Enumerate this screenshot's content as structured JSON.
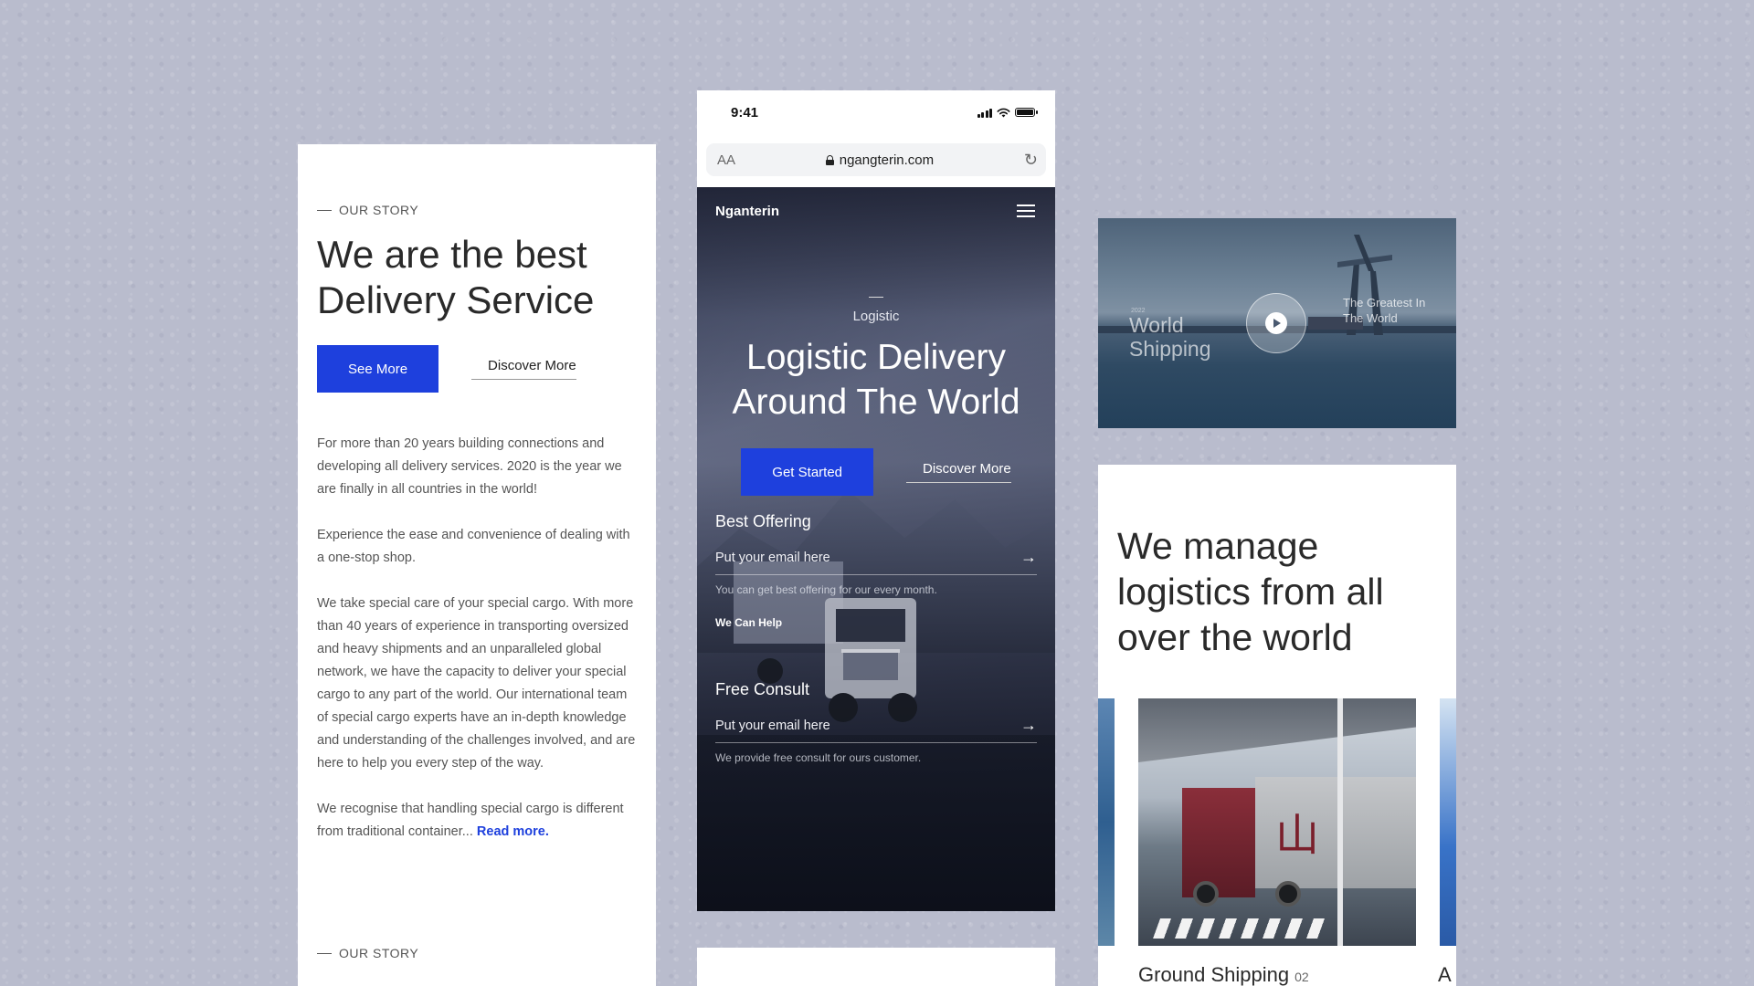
{
  "left_card": {
    "eyebrow": "OUR STORY",
    "title": "We are the best Delivery Service",
    "primary_button": "See More",
    "secondary_button": "Discover More",
    "paragraphs": [
      "For more than 20 years building connections and developing all delivery services. 2020 is the year we are finally in all countries in the world!",
      "Experience the ease and convenience of dealing with a one-stop shop.",
      "We take special care of your special cargo. With more than 40 years of experience in transporting oversized and heavy shipments and an unparalleled global network, we have the capacity to deliver your special cargo to any part of the world. Our international team of special cargo experts have an in-depth knowledge and understanding of the challenges involved, and are here to help you every step of the way.",
      "We recognise that handling special cargo is different from traditional container..."
    ],
    "read_more": "Read more.",
    "eyebrow_bottom": "OUR STORY"
  },
  "phone": {
    "status": {
      "time": "9:41"
    },
    "browser": {
      "text_size": "AA",
      "url": "ngangterin.com"
    },
    "nav": {
      "brand": "Nganterin"
    },
    "hero": {
      "kicker": "Logistic",
      "title": "Logistic Delivery Around The World",
      "primary_button": "Get Started",
      "secondary_button": "Discover More"
    },
    "best_offering": {
      "title": "Best Offering",
      "placeholder": "Put your email here",
      "note": "You can get best offering for our every month.",
      "help": "We Can Help"
    },
    "free_consult": {
      "title": "Free Consult",
      "placeholder": "Put your email here",
      "note": "We provide free consult for ours customer."
    }
  },
  "video_card": {
    "year": "2022",
    "left_text": "World Shipping",
    "right_text": "The Greatest In The World"
  },
  "manage_card": {
    "title": "We manage logistics from all over the world",
    "slide_title": "Ground Shipping",
    "slide_number": "02",
    "next_slide_initial": "A"
  },
  "colors": {
    "accent": "#1e40dd",
    "background": "#b9bccd"
  },
  "icons": {
    "hamburger": "menu-icon",
    "arrow": "arrow-right-icon",
    "play": "play-icon",
    "lock": "lock-icon",
    "reload": "reload-icon"
  }
}
